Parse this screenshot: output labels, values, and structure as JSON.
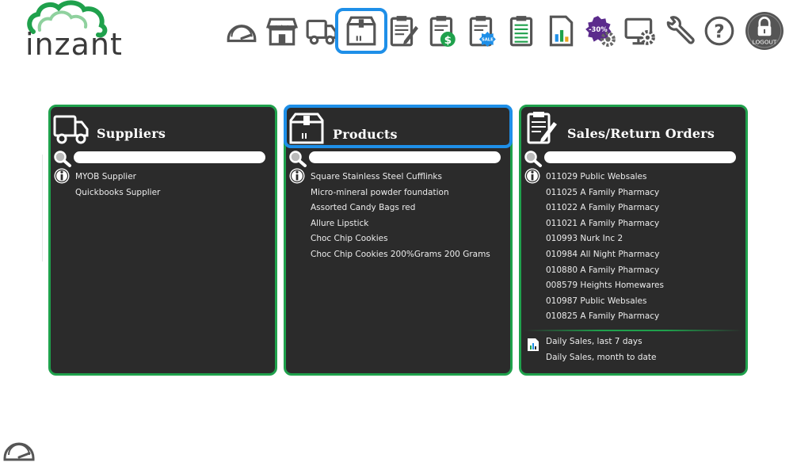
{
  "brand": {
    "name": "inzant",
    "green": "#1fa14c",
    "blue": "#1e8fe8"
  },
  "toolbar": [
    {
      "id": "dashboard",
      "icon": "dashboard-gauge-icon",
      "active": false
    },
    {
      "id": "store",
      "icon": "store-icon",
      "active": false
    },
    {
      "id": "suppliers",
      "icon": "delivery-truck-icon",
      "active": false
    },
    {
      "id": "products",
      "icon": "product-box-icon",
      "active": true
    },
    {
      "id": "orders",
      "icon": "clipboard-edit-icon",
      "active": false
    },
    {
      "id": "payments",
      "icon": "clipboard-dollar-icon",
      "active": false
    },
    {
      "id": "sales",
      "icon": "clipboard-sale-icon",
      "active": false,
      "badge": "SALE"
    },
    {
      "id": "lists",
      "icon": "clipboard-list-icon",
      "active": false
    },
    {
      "id": "reports",
      "icon": "report-chart-icon",
      "active": false
    },
    {
      "id": "discounts",
      "icon": "discount-gear-icon",
      "active": false,
      "badge": "-30%"
    },
    {
      "id": "settings",
      "icon": "monitor-gear-icon",
      "active": false
    },
    {
      "id": "tools",
      "icon": "wrench-icon",
      "active": false
    },
    {
      "id": "help",
      "icon": "help-icon",
      "active": false
    },
    {
      "id": "logout",
      "icon": "logout-lock-icon",
      "active": false,
      "label": "LOGOUT"
    }
  ],
  "panels": {
    "suppliers": {
      "title": "Suppliers",
      "search_placeholder": "",
      "items": [
        "MYOB Supplier",
        "Quickbooks Supplier"
      ]
    },
    "products": {
      "title": "Products",
      "search_placeholder": "",
      "items": [
        "Square Stainless Steel Cufflinks",
        "Micro-mineral powder foundation",
        "Assorted Candy Bags red",
        "Allure Lipstick",
        "Choc Chip Cookies",
        "Choc Chip Cookies 200%Grams 200 Grams"
      ]
    },
    "sales": {
      "title": "Sales/Return Orders",
      "search_placeholder": "",
      "items": [
        "011029 Public Websales",
        "011025 A Family Pharmacy",
        "011022 A Family Pharmacy",
        "011021 A Family Pharmacy",
        "010993 Nurk Inc 2",
        "010984 All Night Pharmacy",
        "010880 A Family Pharmacy",
        "008579 Heights Homewares",
        "010987 Public Websales",
        "010825 A Family Pharmacy"
      ],
      "reports": [
        "Daily Sales, last 7 days",
        "Daily Sales, month to date"
      ]
    }
  }
}
